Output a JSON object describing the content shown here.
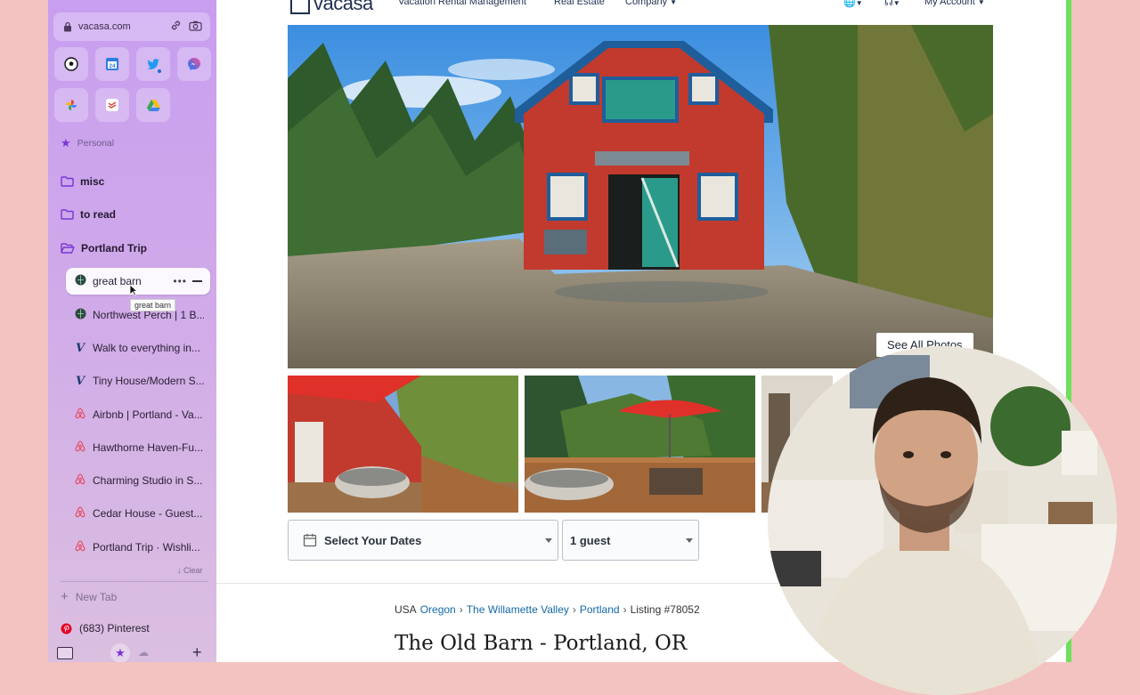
{
  "sidebar": {
    "url": "vacasa.com",
    "favorites": [
      "soccer-icon",
      "calendar-icon",
      "twitter-icon",
      "messenger-icon",
      "photos-icon",
      "todoist-icon",
      "drive-icon"
    ],
    "calendar_day": "24",
    "space_label": "Personal",
    "folders": [
      {
        "label": "misc"
      },
      {
        "label": "to read"
      },
      {
        "label": "Portland Trip"
      }
    ],
    "tabs": [
      {
        "label": "great barn",
        "icon": "vacasa-globe-icon",
        "active": true
      },
      {
        "label": "Northwest Perch | 1 B...",
        "icon": "vacasa-globe-icon"
      },
      {
        "label": "Walk to everything in...",
        "icon": "v-logo-icon"
      },
      {
        "label": "Tiny House/Modern S...",
        "icon": "v-logo-icon"
      },
      {
        "label": "Airbnb | Portland - Va...",
        "icon": "airbnb-icon"
      },
      {
        "label": "Hawthorne Haven-Fu...",
        "icon": "airbnb-icon"
      },
      {
        "label": "Charming Studio in S...",
        "icon": "airbnb-icon"
      },
      {
        "label": "Cedar House - Guest...",
        "icon": "airbnb-icon"
      },
      {
        "label": "Portland Trip · Wishli...",
        "icon": "airbnb-icon"
      }
    ],
    "tooltip": "great barn",
    "clear_label": "↓ Clear",
    "new_tab_label": "New Tab",
    "pinned_tab": "(683) Pinterest"
  },
  "header": {
    "logo": "vacasa",
    "nav": [
      "Vacation Rental Management",
      "Real Estate",
      "Company",
      "My Account"
    ]
  },
  "gallery": {
    "see_all": "See All Photos"
  },
  "booking": {
    "dates_label": "Select Your Dates",
    "guests_value": "1 guest"
  },
  "breadcrumb": {
    "root": "USA",
    "links": [
      "Oregon",
      "The Willamette Valley",
      "Portland"
    ],
    "listing": "Listing #78052"
  },
  "listing": {
    "title": "The Old Barn - Portland, OR"
  },
  "colors": {
    "sidebar_accent": "#7a35d6",
    "link": "#1469a6",
    "barn_red": "#c23a2e",
    "trim_teal": "#2a9b8a",
    "airbnb": "#e8445a",
    "frame_green": "#6ee05c"
  }
}
